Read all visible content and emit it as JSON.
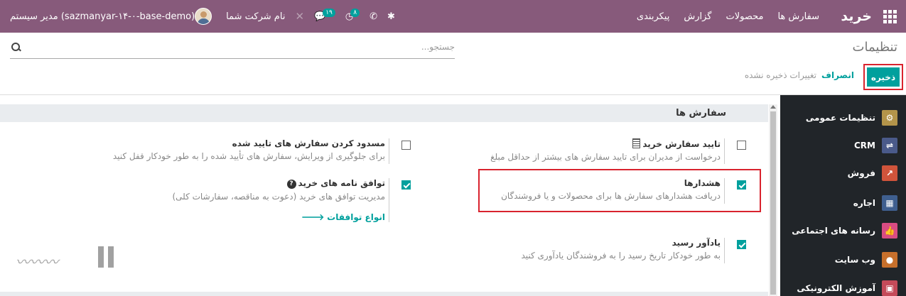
{
  "navbar": {
    "brand": "خرید",
    "menu": [
      "سفارش ها",
      "محصولات",
      "گزارش",
      "پیکربندی"
    ],
    "user_label": "مدیر سیستم (sazmanyar-۱۴-۰-base-demo)",
    "company_label": "نام شرکت شما",
    "messages_count": "۱۹",
    "activities_count": "۸",
    "colors": {
      "bar": "#875a7b"
    }
  },
  "control_panel": {
    "title": "تنظیمات",
    "search_placeholder": "جستجو...",
    "save_label": "ذخیره",
    "discard_label": "انصراف",
    "unsaved_label": "تغییرات ذخیره نشده",
    "colors": {
      "primary": "#00a09d",
      "highlight": "#d9232e"
    }
  },
  "section": {
    "title": "سفارش ها",
    "settings": {
      "po_approval": {
        "title": "تایید سفارش خرید",
        "desc": "درخواست از مدیران برای تایید سفارش های بیشتر از حداقل مبلغ",
        "checked": false
      },
      "lock_orders": {
        "title": "مسدود کردن سفارش های تایید شده",
        "desc": "برای جلوگیری از ویرایش، سفارش های تأیید شده را به طور خودکار قفل کنید",
        "checked": false
      },
      "warnings": {
        "title": "هشدارها",
        "desc": "دریافت هشدارهای سفارش ها برای محصولات و یا فروشندگان",
        "checked": true
      },
      "agreements": {
        "title": "توافق نامه های خرید",
        "desc": "مدیریت توافق های خرید (دعوت به مناقصه، سفارشات کلی)",
        "link": "انواع توافقات",
        "checked": true
      },
      "receipt_reminder": {
        "title": "یادآور رسید",
        "desc": "به طور خودکار تاریخ رسید را به فروشندگان یادآوری کنید",
        "checked": true
      }
    }
  },
  "sidebar": {
    "items": [
      {
        "label": "تنظیمات عمومی",
        "icon": "gear-icon",
        "color": "#b3944a"
      },
      {
        "label": "CRM",
        "icon": "handshake-icon",
        "color": "#4a5a8a"
      },
      {
        "label": "فروش",
        "icon": "chart-icon",
        "color": "#d0543b"
      },
      {
        "label": "اجاره",
        "icon": "calculator-icon",
        "color": "#3f5f8f"
      },
      {
        "label": "رسانه های اجتماعی",
        "icon": "thumbs-up-icon",
        "color": "#d94c82"
      },
      {
        "label": "وب سایت",
        "icon": "globe-icon",
        "color": "#c7702c"
      },
      {
        "label": "آموزش الکترونیکی",
        "icon": "elearning-icon",
        "color": "#c44a59"
      }
    ]
  }
}
